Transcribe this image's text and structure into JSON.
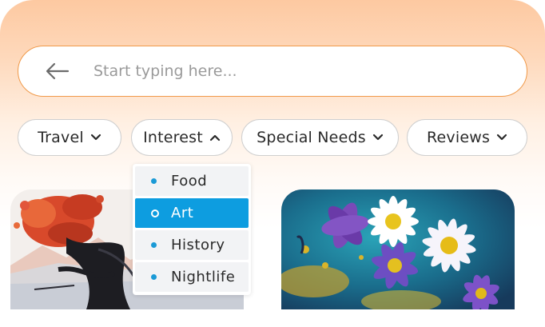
{
  "search": {
    "placeholder": "Start typing here...",
    "back_icon": "arrow-left-icon"
  },
  "filters": [
    {
      "label": "Travel",
      "icon": "chevron-down-icon",
      "open": false
    },
    {
      "label": "Interest",
      "icon": "chevron-up-icon",
      "open": true
    },
    {
      "label": "Special Needs",
      "icon": "chevron-down-icon",
      "open": false
    },
    {
      "label": "Reviews",
      "icon": "chevron-down-icon",
      "open": false
    }
  ],
  "dropdown": {
    "items": [
      {
        "label": "Food",
        "selected": false
      },
      {
        "label": "Art",
        "selected": true
      },
      {
        "label": "History",
        "selected": false
      },
      {
        "label": "Nightlife",
        "selected": false
      }
    ]
  },
  "cards": [
    {
      "image": "abstract-tree-painting"
    },
    {
      "image": "daisy-flowers-painting"
    }
  ],
  "colors": {
    "accent": "#f09a4a",
    "selected": "#0d9de0",
    "bullet": "#1b9ad6",
    "header_gradient_top": "#fdc9a1"
  }
}
